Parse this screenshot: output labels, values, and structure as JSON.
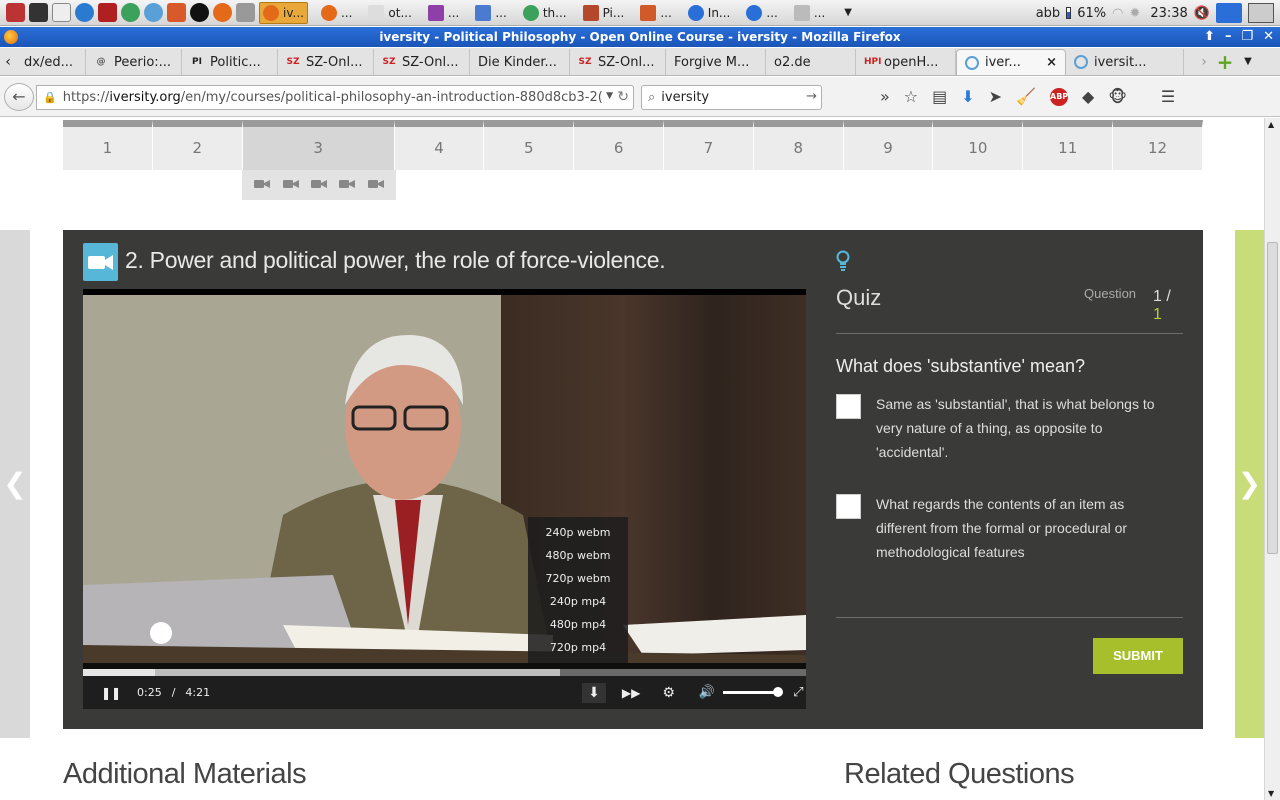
{
  "taskbar": {
    "apps": [
      {
        "label": "iv...",
        "icon": "firefox-icon",
        "active": true
      },
      {
        "label": "...",
        "icon": "firefox-icon"
      },
      {
        "label": "ot...",
        "icon": "text-editor-icon"
      },
      {
        "label": "...",
        "icon": "onenote-icon"
      },
      {
        "label": "...",
        "icon": "document-icon"
      },
      {
        "label": "th...",
        "icon": "chrome-icon"
      },
      {
        "label": "Pi...",
        "icon": "image-viewer-icon"
      },
      {
        "label": "...",
        "icon": "photo-icon"
      },
      {
        "label": "In...",
        "icon": "browser-icon"
      },
      {
        "label": "...",
        "icon": "browser-icon"
      },
      {
        "label": "...",
        "icon": "network-icon"
      }
    ],
    "tray": {
      "user": "abb",
      "battery": "61%",
      "clock": "23:38"
    }
  },
  "window": {
    "title": "iversity - Political Philosophy - Open Online Course - iversity - Mozilla Firefox"
  },
  "tabs": [
    {
      "label": "dx/ed...",
      "favicon": ""
    },
    {
      "label": "Peerio:...",
      "favicon": "@"
    },
    {
      "label": "Politic...",
      "favicon": "PI"
    },
    {
      "label": "SZ-Onl...",
      "favicon": "SZ"
    },
    {
      "label": "SZ-Onl...",
      "favicon": "SZ"
    },
    {
      "label": "Die Kinder...",
      "favicon": ""
    },
    {
      "label": "SZ-Onl...",
      "favicon": "SZ"
    },
    {
      "label": "Forgive M...",
      "favicon": ""
    },
    {
      "label": "o2.de",
      "favicon": ""
    },
    {
      "label": "openH...",
      "favicon": "HPI"
    },
    {
      "label": "iver...",
      "favicon": "O",
      "active": true,
      "close": "×"
    },
    {
      "label": "iversit...",
      "favicon": "O"
    }
  ],
  "nav": {
    "url_prefix": "https://",
    "url_domain": "iversity.org",
    "url_path": "/en/my/courses/political-philosophy-an-introduction-880d8cb3-2(",
    "search_value": "iversity"
  },
  "steps": [
    "1",
    "2",
    "3",
    "4",
    "5",
    "6",
    "7",
    "8",
    "9",
    "10",
    "11",
    "12"
  ],
  "lecture": {
    "title": "2. Power and political power, the role of force-violence.",
    "video": {
      "current_time": "0:25",
      "separator": "/",
      "duration": "4:21",
      "progress_played": 0.1,
      "progress_buffered": 0.66,
      "quality_options": [
        "240p webm",
        "480p webm",
        "720p webm",
        "240p mp4",
        "480p mp4",
        "720p mp4"
      ]
    }
  },
  "quiz": {
    "title": "Quiz",
    "question_label": "Question",
    "current": "1",
    "separator": " / ",
    "total": "1",
    "question": "What does 'substantive' mean?",
    "options": [
      "Same as 'substantial', that is what belongs to very nature of a thing, as opposite to 'accidental'.",
      "What regards the contents of an item as different from the formal or procedural or methodological features"
    ],
    "submit_label": "SUBMIT"
  },
  "sections": {
    "additional_materials": "Additional Materials",
    "related_questions": "Related Questions"
  },
  "colors": {
    "accent_green": "#a6bf2a",
    "accent_blue": "#57b7d9",
    "dark_panel": "#3a3a38"
  }
}
